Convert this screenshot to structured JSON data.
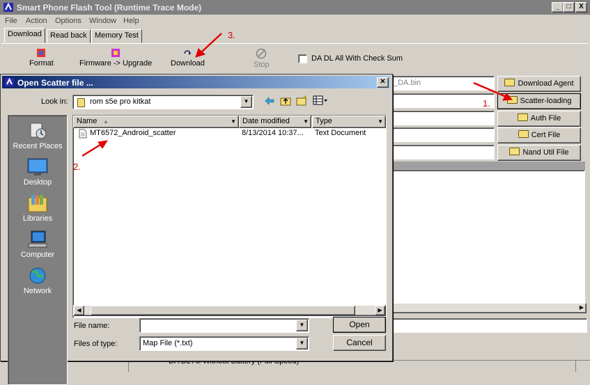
{
  "window": {
    "title": "Smart Phone Flash Tool (Runtime Trace Mode)",
    "controls": [
      "_",
      "□",
      "X"
    ]
  },
  "menu": [
    "File",
    "Action",
    "Options",
    "Window",
    "Help"
  ],
  "tabs": [
    "Download",
    "Read back",
    "Memory Test"
  ],
  "toolbar": {
    "format": "Format",
    "firmware_upgrade": "Firmware -> Upgrade",
    "download": "Download",
    "stop": "Stop",
    "checksum_label": "DA DL All With Check Sum"
  },
  "side_buttons": [
    "Download Agent",
    "Scatter-loading",
    "Auth File",
    "Cert File",
    "Nand Util File"
  ],
  "da_path_fragment": "_DA.bin",
  "status_bar_text": "DA DL All Without Battery (Full Speed)",
  "dialog": {
    "title": "Open Scatter file ...",
    "look_in_label": "Look in:",
    "look_in_value": "rom s5e pro kitkat",
    "places": [
      "Recent Places",
      "Desktop",
      "Libraries",
      "Computer",
      "Network"
    ],
    "columns": [
      "Name",
      "Date modified",
      "Type"
    ],
    "files": [
      {
        "name": "MT6572_Android_scatter",
        "date": "8/13/2014 10:37...",
        "type": "Text Document"
      }
    ],
    "file_name_label": "File name:",
    "file_name_value": "",
    "files_of_type_label": "Files of type:",
    "files_of_type_value": "Map File (*.txt)",
    "open_label": "Open",
    "cancel_label": "Cancel"
  },
  "annotations": [
    "1.",
    "2.",
    "3."
  ]
}
